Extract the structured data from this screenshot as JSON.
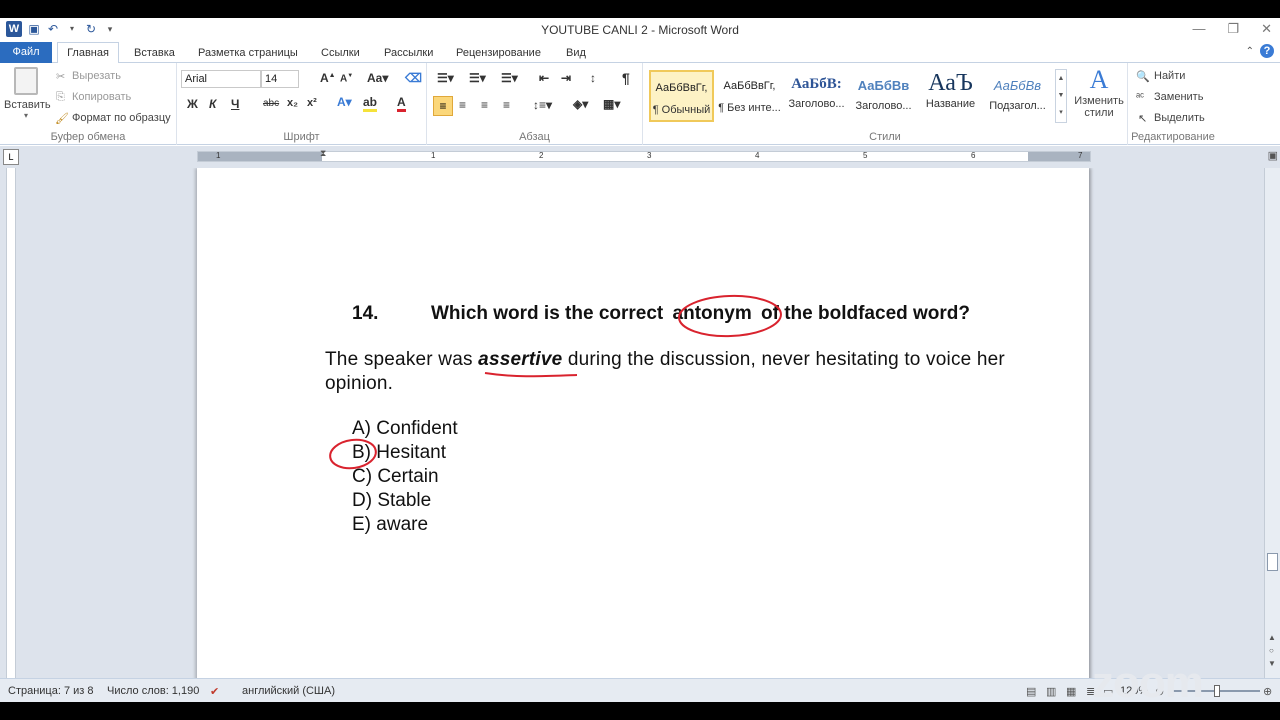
{
  "window": {
    "title": "YOUTUBE CANLI 2 - Microsoft Word",
    "app_icon": "W"
  },
  "tabs": [
    "Файл",
    "Главная",
    "Вставка",
    "Разметка страницы",
    "Ссылки",
    "Рассылки",
    "Рецензирование",
    "Вид"
  ],
  "ribbon": {
    "clipboard": {
      "paste": "Вставить",
      "cut": "Вырезать",
      "copy": "Копировать",
      "format_painter": "Формат по образцу",
      "label": "Буфер обмена"
    },
    "font": {
      "name": "Arial",
      "size": "14",
      "label": "Шрифт",
      "bold": "Ж",
      "italic": "К",
      "underline": "Ч",
      "strike": "abc",
      "subscript": "x₂",
      "superscript": "x²"
    },
    "paragraph": {
      "label": "Абзац"
    },
    "styles": {
      "label": "Стили",
      "items": [
        {
          "preview": "АаБбВвГг,",
          "name": "¶ Обычный"
        },
        {
          "preview": "АаБбВвГг,",
          "name": "¶ Без инте..."
        },
        {
          "preview": "АаБбВ:",
          "name": "Заголово..."
        },
        {
          "preview": "АаБбВв",
          "name": "Заголово..."
        },
        {
          "preview": "АаЪ",
          "name": "Название"
        },
        {
          "preview": "АаБбВв",
          "name": "Подзагол..."
        }
      ],
      "change_styles": "Изменить стили"
    },
    "editing": {
      "label": "Редактирование",
      "find": "Найти",
      "replace": "Заменить",
      "select": "Выделить"
    }
  },
  "ruler": {
    "numbers": [
      "1",
      "1",
      "2",
      "3",
      "4",
      "5",
      "6",
      "7"
    ]
  },
  "document": {
    "question_number": "14.",
    "question_before": "Which word is the correct",
    "question_keyword": "antonym",
    "question_after": "of the boldfaced word?",
    "stem_before": "The speaker was",
    "stem_keyword": "assertive",
    "stem_after": "during the discussion, never hesitating to voice her opinion.",
    "options": [
      "A) Confident",
      "B) Hesitant",
      "C) Certain",
      "D) Stable",
      "E) aware"
    ],
    "annotation_color": "#d9232e"
  },
  "statusbar": {
    "page": "Страница: 7 из 8",
    "words": "Число слов: 1,190",
    "language": "английский (США)",
    "zoom": "120%"
  },
  "watermark": "zoom"
}
